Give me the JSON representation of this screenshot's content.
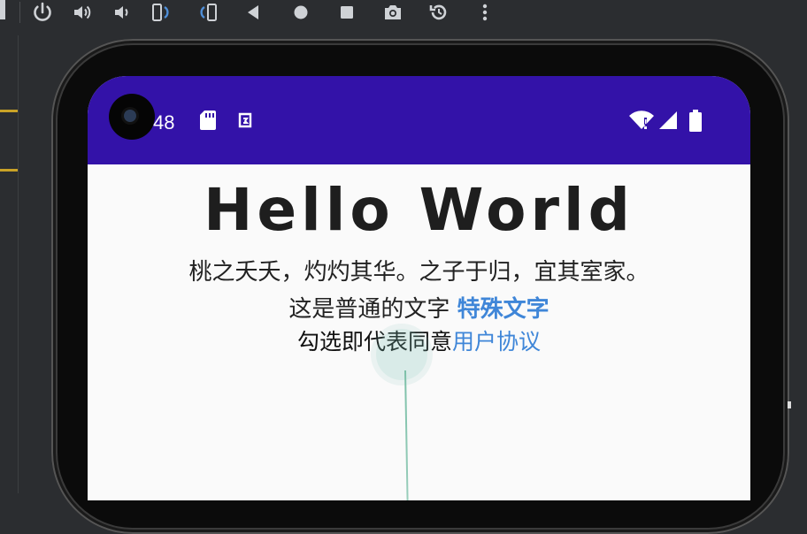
{
  "toolbar": {
    "buttons": [
      {
        "name": "power-button",
        "icon": "power-icon"
      },
      {
        "name": "volume-up-button",
        "icon": "volume-up-icon"
      },
      {
        "name": "volume-down-button",
        "icon": "volume-down-icon"
      },
      {
        "name": "rotate-left-button",
        "icon": "rotate-left-icon"
      },
      {
        "name": "rotate-right-button",
        "icon": "rotate-right-icon"
      },
      {
        "name": "back-button",
        "icon": "back-triangle-icon"
      },
      {
        "name": "home-button",
        "icon": "home-circle-icon"
      },
      {
        "name": "overview-button",
        "icon": "overview-square-icon"
      },
      {
        "name": "screenshot-button",
        "icon": "camera-icon"
      },
      {
        "name": "snapshot-button",
        "icon": "snapshot-restore-icon"
      },
      {
        "name": "more-button",
        "icon": "more-vertical-icon"
      }
    ]
  },
  "status_bar": {
    "time": "48",
    "left_icons": [
      "sd-card-icon",
      "accessibility-icon"
    ],
    "right_icons": [
      "wifi-alert-icon",
      "cell-signal-icon",
      "battery-icon"
    ],
    "background": "#3312a8"
  },
  "content": {
    "title": "Hello World",
    "poem": "桃之夭夭，灼灼其华。之子于归，宜其室家。",
    "normal_text": "这是普通的文字",
    "special_text": "特殊文字",
    "agree_text": "勾选即代表同意",
    "agreement_link": "用户协议",
    "link_color": "#3f86d8"
  }
}
